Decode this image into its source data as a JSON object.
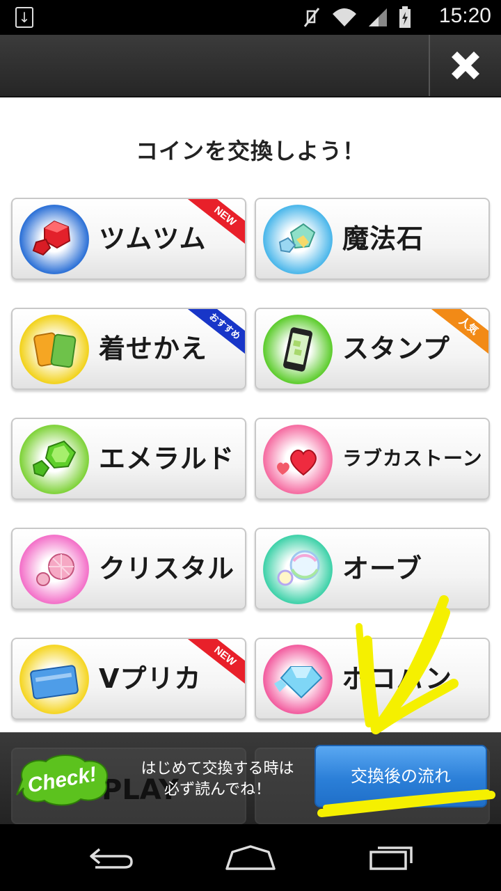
{
  "status_bar": {
    "time": "15:20",
    "icons": [
      "download-icon",
      "mute-icon",
      "wifi-icon",
      "signal-icon",
      "battery-icon"
    ]
  },
  "title_bar": {
    "close_icon": "close-icon"
  },
  "heading": "コインを交換しよう！",
  "cards": [
    {
      "label": "ツムツム",
      "icon": "ruby-gems-icon",
      "glow": "#2a6fd6",
      "ribbon": "NEW",
      "ribbon_color": "#e8202a"
    },
    {
      "label": "魔法石",
      "icon": "magic-stones-icon",
      "glow": "#49b6ea",
      "ribbon": "",
      "ribbon_color": ""
    },
    {
      "label": "着せかえ",
      "icon": "theme-phones-icon",
      "glow": "#f2d21a",
      "ribbon": "おすすめ",
      "ribbon_color": "#1836c8"
    },
    {
      "label": "スタンプ",
      "icon": "smartphone-icon",
      "glow": "#5ccc2c",
      "ribbon": "人気",
      "ribbon_color": "#f28a16"
    },
    {
      "label": "エメラルド",
      "icon": "emerald-icon",
      "glow": "#7ed238",
      "ribbon": "",
      "ribbon_color": ""
    },
    {
      "label": "ラブカストーン",
      "icon": "heart-stones-icon",
      "glow": "#f56aa0",
      "ribbon": "",
      "ribbon_color": ""
    },
    {
      "label": "クリスタル",
      "icon": "crystal-icon",
      "glow": "#f36fc8",
      "ribbon": "",
      "ribbon_color": ""
    },
    {
      "label": "オーブ",
      "icon": "orb-icon",
      "glow": "#3dd1a8",
      "ribbon": "",
      "ribbon_color": ""
    },
    {
      "label": "Vプリカ",
      "icon": "prepaid-card-icon",
      "glow": "#f5d520",
      "ribbon": "NEW",
      "ribbon_color": "#e8202a"
    },
    {
      "label": "ポコパン",
      "icon": "diamond-icon",
      "glow": "#f25b9e",
      "ribbon": "",
      "ribbon_color": ""
    }
  ],
  "banner": {
    "check_label": "Check!",
    "notice_line1": "はじめて交換する時は",
    "notice_line2": "必ず読んでね！",
    "flow_button": "交換後の流れ",
    "ghost_label": "PLAY"
  },
  "nav_bar": {
    "back_icon": "back-icon",
    "home_icon": "home-icon",
    "recents_icon": "recents-icon"
  },
  "colors": {
    "annotation": "#f5f000",
    "flow_button": "#2b7fd8",
    "check_bubble": "#5cc21e"
  }
}
